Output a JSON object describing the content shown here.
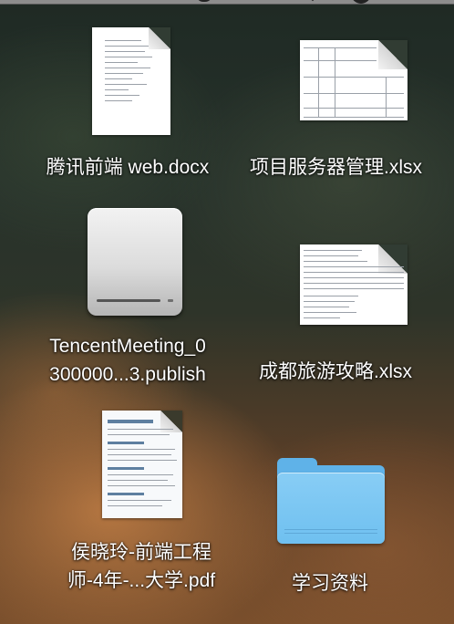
{
  "desktop": {
    "items": [
      {
        "kind": "docx",
        "label_lines": [
          "腾讯前端 web.docx"
        ]
      },
      {
        "kind": "xlsx",
        "label_lines": [
          "项目服务器管理.xlsx"
        ]
      },
      {
        "kind": "drive",
        "label_lines": [
          "TencentMeeting_0",
          "300000...3.publish"
        ]
      },
      {
        "kind": "xlsx",
        "label_lines": [
          "成都旅游攻略.xlsx"
        ]
      },
      {
        "kind": "pdf",
        "label_lines": [
          "侯晓玲-前端工程",
          "师-4年-...大学.pdf"
        ]
      },
      {
        "kind": "folder",
        "label_lines": [
          "学习资料"
        ]
      }
    ]
  },
  "colors": {
    "folder": "#6fc0f0",
    "label_text": "#ffffff"
  },
  "icons": {
    "docx": "word-document-icon",
    "xlsx": "spreadsheet-document-icon",
    "drive": "disk-image-drive-icon",
    "pdf": "pdf-document-icon",
    "folder": "folder-icon"
  }
}
